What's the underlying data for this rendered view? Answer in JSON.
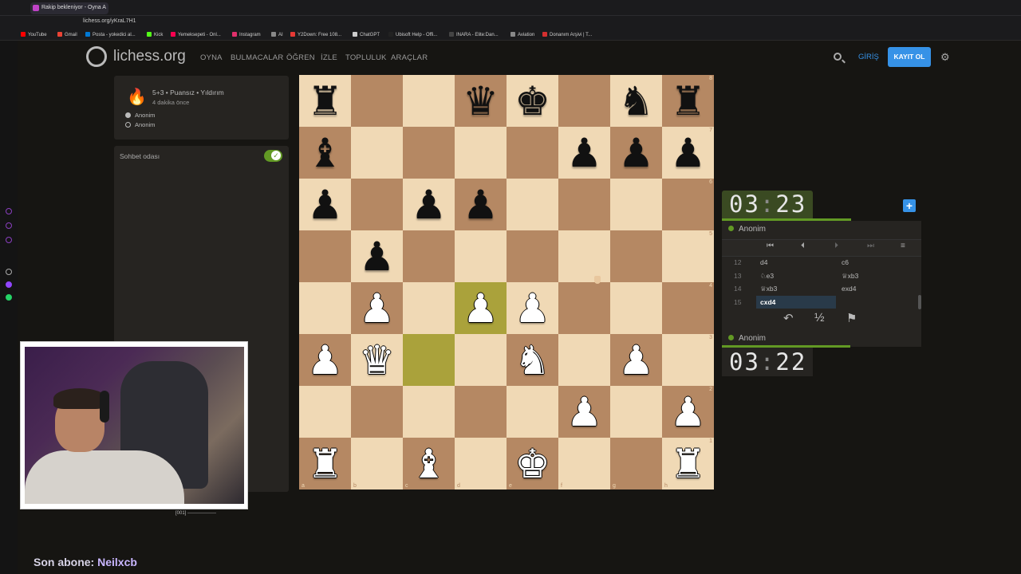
{
  "browser": {
    "tab_title": "Rakip bekleniyor - Oyna A",
    "url": "lichess.org/yKraL7H1",
    "bookmarks": [
      {
        "label": "YouTube",
        "color": "#ff0000"
      },
      {
        "label": "Gmail",
        "color": "#ea4335"
      },
      {
        "label": "Posta - yokedici al...",
        "color": "#0078d4"
      },
      {
        "label": "Kick",
        "color": "#53fc18"
      },
      {
        "label": "Yemeksepeti - Onl...",
        "color": "#fa0050"
      },
      {
        "label": "Instagram",
        "color": "#e1306c"
      },
      {
        "label": "AI",
        "color": "#888888"
      },
      {
        "label": "Y2Down: Free 108...",
        "color": "#e53935"
      },
      {
        "label": "ChatGPT",
        "color": "#cccccc"
      },
      {
        "label": "Ubisoft Help - Offi...",
        "color": "#222222"
      },
      {
        "label": "INARA - Elite:Dan...",
        "color": "#444444"
      },
      {
        "label": "Aviation",
        "color": "#888888"
      },
      {
        "label": "Donanım Arşivi | T...",
        "color": "#d32f2f"
      }
    ]
  },
  "site": {
    "logo_text": "lichess.org",
    "nav": [
      "OYNA",
      "BULMACALAR",
      "ÖĞREN",
      "İZLE",
      "TOPLULUK",
      "ARAÇLAR"
    ],
    "login": "GİRİŞ",
    "signup": "KAYIT OL"
  },
  "game": {
    "title": "5+3 • Puansız • Yıldırım",
    "time_ago": "4 dakika önce",
    "players": [
      "Anonim",
      "Anonim"
    ],
    "chat_label": "Sohbet odası"
  },
  "board": {
    "ranks": [
      "r..qk.nr",
      "b....ppp",
      "p.pp....",
      ".p......",
      ".P.PP...",
      "PQ..N.P.",
      ".....P.P",
      "R.B.K..R"
    ],
    "highlight": [
      "c3",
      "d4"
    ],
    "files": [
      "a",
      "b",
      "c",
      "d",
      "e",
      "f",
      "g",
      "h"
    ],
    "rank_labels": [
      "8",
      "7",
      "6",
      "5",
      "4",
      "3",
      "2",
      "1"
    ]
  },
  "clock": {
    "top_min": "03",
    "top_sec": "23",
    "top_player": "Anonim",
    "bottom_min": "03",
    "bottom_sec": "22",
    "bottom_player": "Anonim"
  },
  "moves": [
    {
      "n": "12",
      "w": "d4",
      "b": "c6"
    },
    {
      "n": "13",
      "w": "♘e3",
      "b": "♕xb3"
    },
    {
      "n": "14",
      "w": "♕xb3",
      "b": "exd4"
    },
    {
      "n": "15",
      "w": "cxd4",
      "b": ""
    }
  ],
  "actions": {
    "takeback": "↶",
    "draw": "½",
    "resign": "⚑"
  },
  "stream": {
    "sub_label": "Son abone:",
    "sub_name": "Neilxcb",
    "cam_caption": "[001] ------------------"
  },
  "colors": {
    "accent": "#3692e7",
    "clock_active": "#629924",
    "light_square": "#f0d9b5",
    "dark_square": "#b58863"
  }
}
